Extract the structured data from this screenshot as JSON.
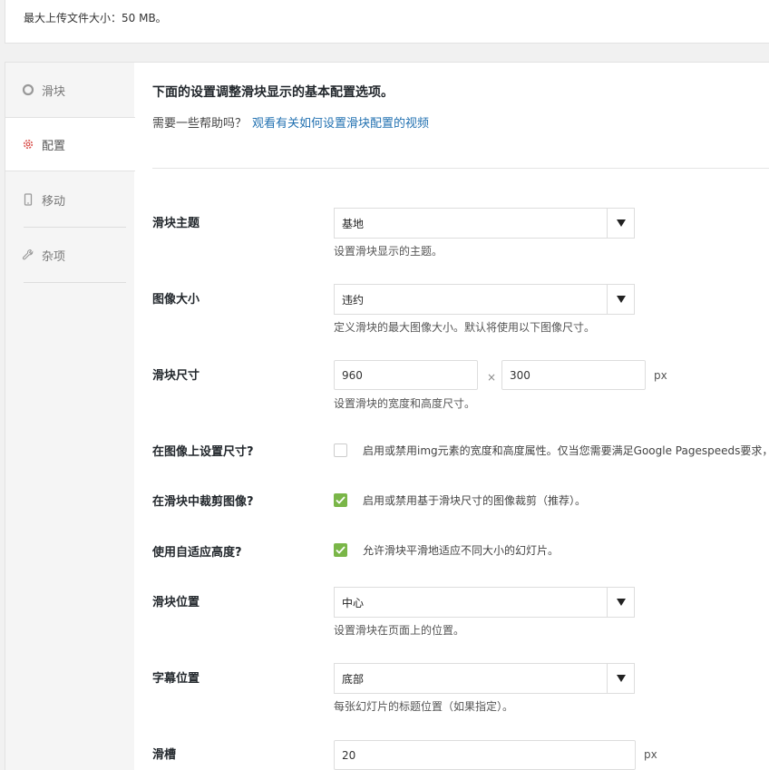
{
  "top": {
    "max_upload": "最大上传文件大小：50 MB。"
  },
  "sidebar": {
    "items": [
      {
        "label": "滑块",
        "icon": "circle-icon"
      },
      {
        "label": "配置",
        "icon": "gear-icon"
      },
      {
        "label": "移动",
        "icon": "mobile-icon"
      },
      {
        "label": "杂项",
        "icon": "wrench-icon"
      }
    ]
  },
  "main": {
    "heading": "下面的设置调整滑块显示的基本配置选项。",
    "help_text": "需要一些帮助吗？",
    "help_link": "观看有关如何设置滑块配置的视频"
  },
  "fields": {
    "theme": {
      "label": "滑块主题",
      "value": "基地",
      "desc": "设置滑块显示的主题。"
    },
    "image_size": {
      "label": "图像大小",
      "value": "违约",
      "desc": "定义滑块的最大图像大小。默认将使用以下图像尺寸。"
    },
    "slider_size": {
      "label": "滑块尺寸",
      "width": "960",
      "height": "300",
      "times": "×",
      "unit": "px",
      "desc": "设置滑块的宽度和高度尺寸。"
    },
    "set_dims": {
      "label": "在图像上设置尺寸?",
      "checked": false,
      "text": "启用或禁用img元素的宽度和高度属性。仅当您需要满足Google Pagespeeds要求，"
    },
    "crop": {
      "label": "在滑块中裁剪图像?",
      "checked": true,
      "text": "启用或禁用基于滑块尺寸的图像裁剪（推荐）。"
    },
    "adaptive": {
      "label": "使用自适应高度?",
      "checked": true,
      "text": "允许滑块平滑地适应不同大小的幻灯片。"
    },
    "position": {
      "label": "滑块位置",
      "value": "中心",
      "desc": "设置滑块在页面上的位置。"
    },
    "caption": {
      "label": "字幕位置",
      "value": "底部",
      "desc": "每张幻灯片的标题位置（如果指定）。"
    },
    "gutter": {
      "label": "滑槽",
      "value": "20",
      "unit": "px"
    }
  },
  "colors": {
    "accent": "#2271b1",
    "check": "#7ab648"
  }
}
